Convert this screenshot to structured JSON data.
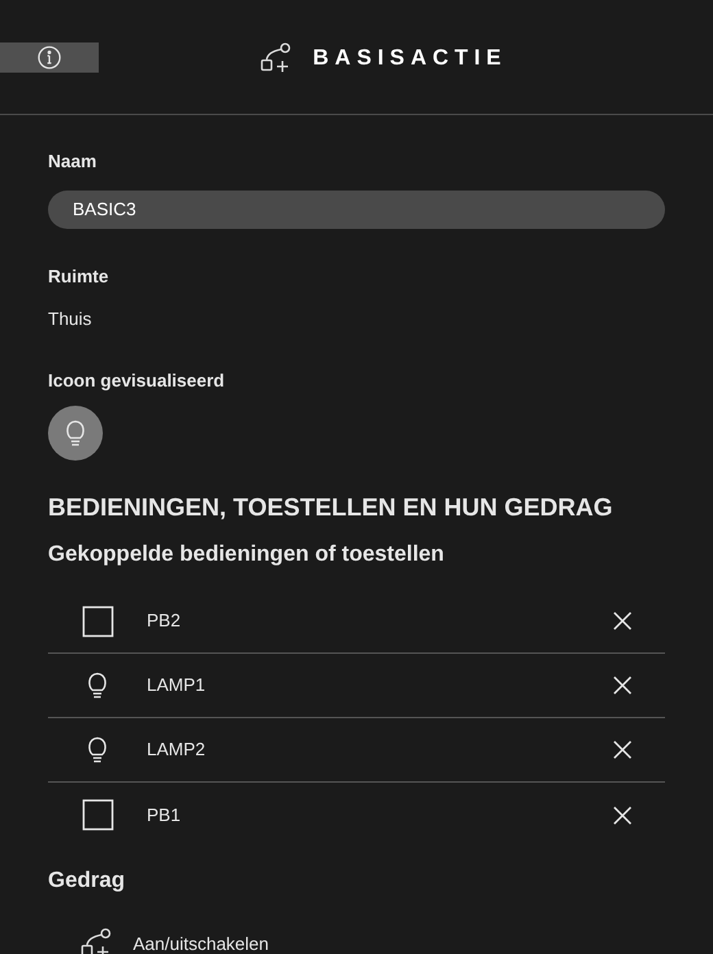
{
  "header": {
    "title": "BASISACTIE"
  },
  "fields": {
    "name_label": "Naam",
    "name_value": "BASIC3",
    "room_label": "Ruimte",
    "room_value": "Thuis",
    "icon_label": "Icoon gevisualiseerd"
  },
  "section_title": "BEDIENINGEN, TOESTELLEN EN HUN GEDRAG",
  "linked_title": "Gekoppelde bedieningen of toestellen",
  "devices": [
    {
      "kind": "button",
      "label": "PB2"
    },
    {
      "kind": "lamp",
      "label": "LAMP1"
    },
    {
      "kind": "lamp",
      "label": "LAMP2"
    },
    {
      "kind": "button",
      "label": "PB1"
    }
  ],
  "behavior_title": "Gedrag",
  "behaviors": [
    {
      "label": "Aan/uitschakelen"
    }
  ]
}
